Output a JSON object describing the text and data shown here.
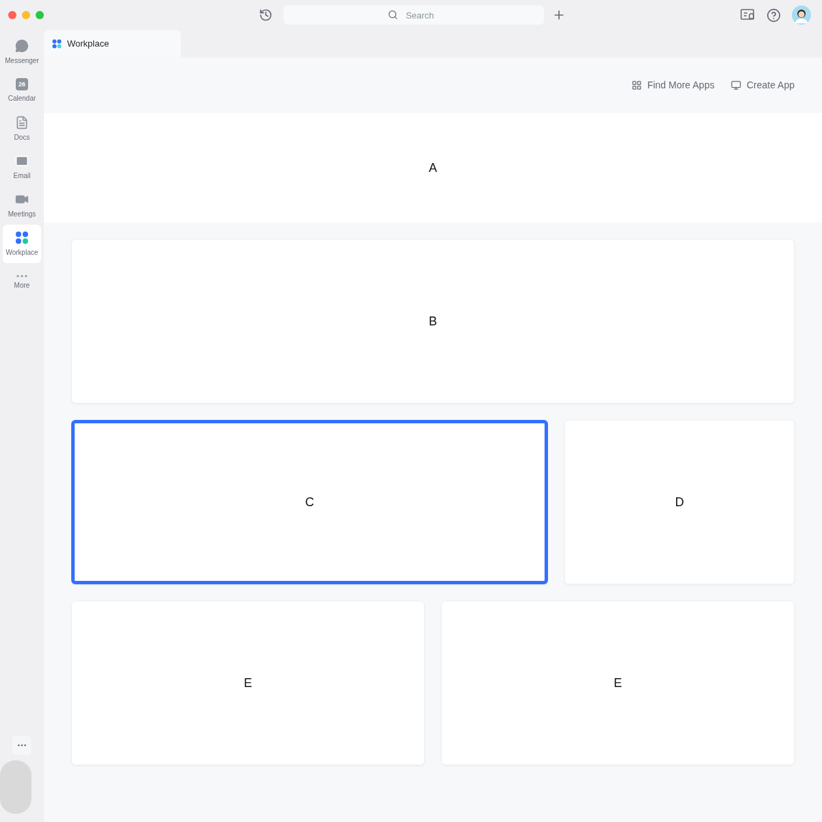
{
  "toolbar": {
    "search": {
      "placeholder": "Search"
    }
  },
  "sidebar": {
    "items": [
      {
        "kind": "messenger",
        "label": "Messenger",
        "selected": false
      },
      {
        "kind": "calendar",
        "label": "Calendar",
        "icon_text": "26",
        "selected": false
      },
      {
        "kind": "docs",
        "label": "Docs",
        "selected": false
      },
      {
        "kind": "email",
        "label": "Email",
        "selected": false
      },
      {
        "kind": "meetings",
        "label": "Meetings",
        "selected": false
      },
      {
        "kind": "workplace",
        "label": "Workplace",
        "selected": true
      },
      {
        "kind": "more",
        "label": "More",
        "selected": false
      }
    ]
  },
  "tab": {
    "label": "Workplace"
  },
  "actions": [
    {
      "kind": "find",
      "label": "Find More Apps"
    },
    {
      "kind": "create",
      "label": "Create App"
    }
  ],
  "banner": {
    "label": "A"
  },
  "cards": [
    {
      "label": "B",
      "selected": false
    },
    {
      "label": "C",
      "selected": true
    },
    {
      "label": "D",
      "selected": false
    },
    {
      "label": "E",
      "selected": false
    },
    {
      "label": "E",
      "selected": false
    }
  ]
}
